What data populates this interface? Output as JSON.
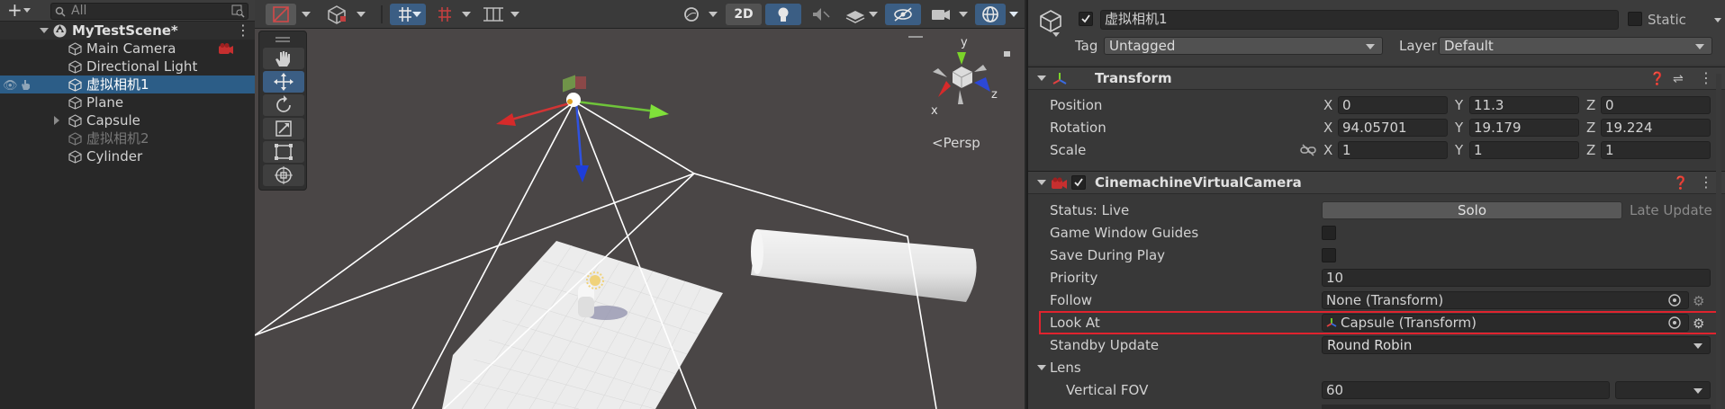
{
  "hierarchy": {
    "add_label": "+",
    "search_placeholder": "All",
    "scene_name": "MyTestScene*",
    "items": [
      {
        "label": "Main Camera"
      },
      {
        "label": "Directional Light"
      },
      {
        "label": "虚拟相机1"
      },
      {
        "label": "Plane"
      },
      {
        "label": "Capsule"
      },
      {
        "label": "虚拟相机2"
      },
      {
        "label": "Cylinder"
      }
    ]
  },
  "scene": {
    "mode_2d": "2D",
    "persp_label": "<Persp",
    "gizmo_y": "y",
    "gizmo_x": "x",
    "gizmo_z": "z"
  },
  "inspector": {
    "object_name": "虚拟相机1",
    "static_label": "Static",
    "tag_label": "Tag",
    "tag_value": "Untagged",
    "layer_label": "Layer",
    "layer_value": "Default",
    "transform": {
      "title": "Transform",
      "position_label": "Position",
      "rotation_label": "Rotation",
      "scale_label": "Scale",
      "x": "X",
      "y": "Y",
      "z": "Z",
      "position": [
        "0",
        "11.3",
        "0"
      ],
      "rotation": [
        "94.05701",
        "19.179",
        "19.224"
      ],
      "scale": [
        "1",
        "1",
        "1"
      ]
    },
    "vcam": {
      "title": "CinemachineVirtualCamera",
      "status_label": "Status: Live",
      "solo_label": "Solo",
      "late_update_label": "Late Update",
      "game_window_guides_label": "Game Window Guides",
      "save_during_play_label": "Save During Play",
      "priority_label": "Priority",
      "priority_value": "10",
      "follow_label": "Follow",
      "follow_value": "None (Transform)",
      "look_at_label": "Look At",
      "look_at_value": "Capsule (Transform)",
      "standby_label": "Standby Update",
      "standby_value": "Round Robin",
      "lens_label": "Lens",
      "vfov_label": "Vertical FOV",
      "vfov_value": "60"
    }
  },
  "colors": {
    "selection": "#2c5d87",
    "highlight_border": "#e0232e",
    "axis_red": "#e02020",
    "axis_green": "#7bd42a",
    "axis_blue": "#2546e0"
  }
}
